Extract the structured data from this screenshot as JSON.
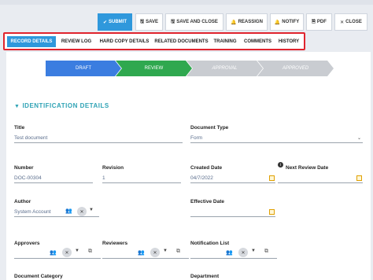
{
  "toolbar": {
    "submit": "SUBMIT",
    "save": "SAVE",
    "save_close": "SAVE AND CLOSE",
    "reassign": "REASSIGN",
    "notify": "NOTIFY",
    "pdf": "PDF",
    "close": "CLOSE"
  },
  "tabs": [
    "RECORD DETAILS",
    "REVIEW LOG",
    "HARD COPY DETAILS",
    "RELATED DOCUMENTS",
    "TRAINING",
    "COMMENTS",
    "HISTORY"
  ],
  "workflow": [
    "DRAFT",
    "REVIEW",
    "APPROVAL",
    "APPROVED"
  ],
  "section": "IDENTIFICATION DETAILS",
  "fields": {
    "title_label": "Title",
    "title_value": "Test document",
    "doc_type_label": "Document Type",
    "doc_type_value": "Form",
    "number_label": "Number",
    "number_value": "DOC-00304",
    "revision_label": "Revision",
    "revision_value": "1",
    "created_label": "Created Date",
    "created_value": "04/7/2022",
    "next_review_label": "Next Review Date",
    "author_label": "Author",
    "author_value": "System Account",
    "effective_label": "Effective Date",
    "approvers_label": "Approvers",
    "reviewers_label": "Reviewers",
    "notification_label": "Notification List",
    "doc_category_label": "Document Category",
    "department_label": "Department"
  },
  "colors": {
    "accent": "#2f98dc",
    "workflow_done": "#3b7de0",
    "workflow_current": "#2fa84f",
    "workflow_pending": "#c9ccd1",
    "tabs_border": "#e0242e",
    "section": "#2fa3b5"
  }
}
